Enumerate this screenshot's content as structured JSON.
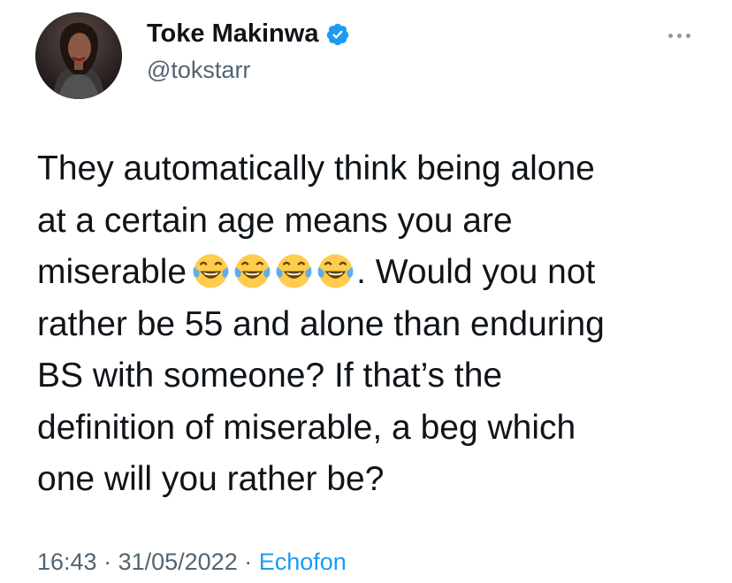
{
  "author": {
    "display_name": "Toke Makinwa",
    "handle": "@tokstarr",
    "verified": true
  },
  "tweet": {
    "line_1": "They automatically think being alone",
    "line_2": "at a certain age means you are",
    "line_3_before_emoji": "miserable",
    "emoji": [
      "face-with-tears-of-joy",
      "face-with-tears-of-joy",
      "face-with-tears-of-joy",
      "face-with-tears-of-joy"
    ],
    "line_3_after_emoji": ". Would you not",
    "line_4": "rather be 55 and alone than enduring",
    "line_5": "BS with someone? If that’s the",
    "line_6": "definition of miserable, a beg which",
    "line_7": "one will you rather be?"
  },
  "meta": {
    "time": "16:43",
    "separator": " · ",
    "date": "31/05/2022",
    "source": "Echofon"
  },
  "colors": {
    "text": "#0f1419",
    "secondary": "#536471",
    "accent": "#1d9bf0",
    "verified": "#1d9bf0"
  },
  "icons": {
    "verified": "verified-badge-icon",
    "more": "more-options-icon"
  }
}
